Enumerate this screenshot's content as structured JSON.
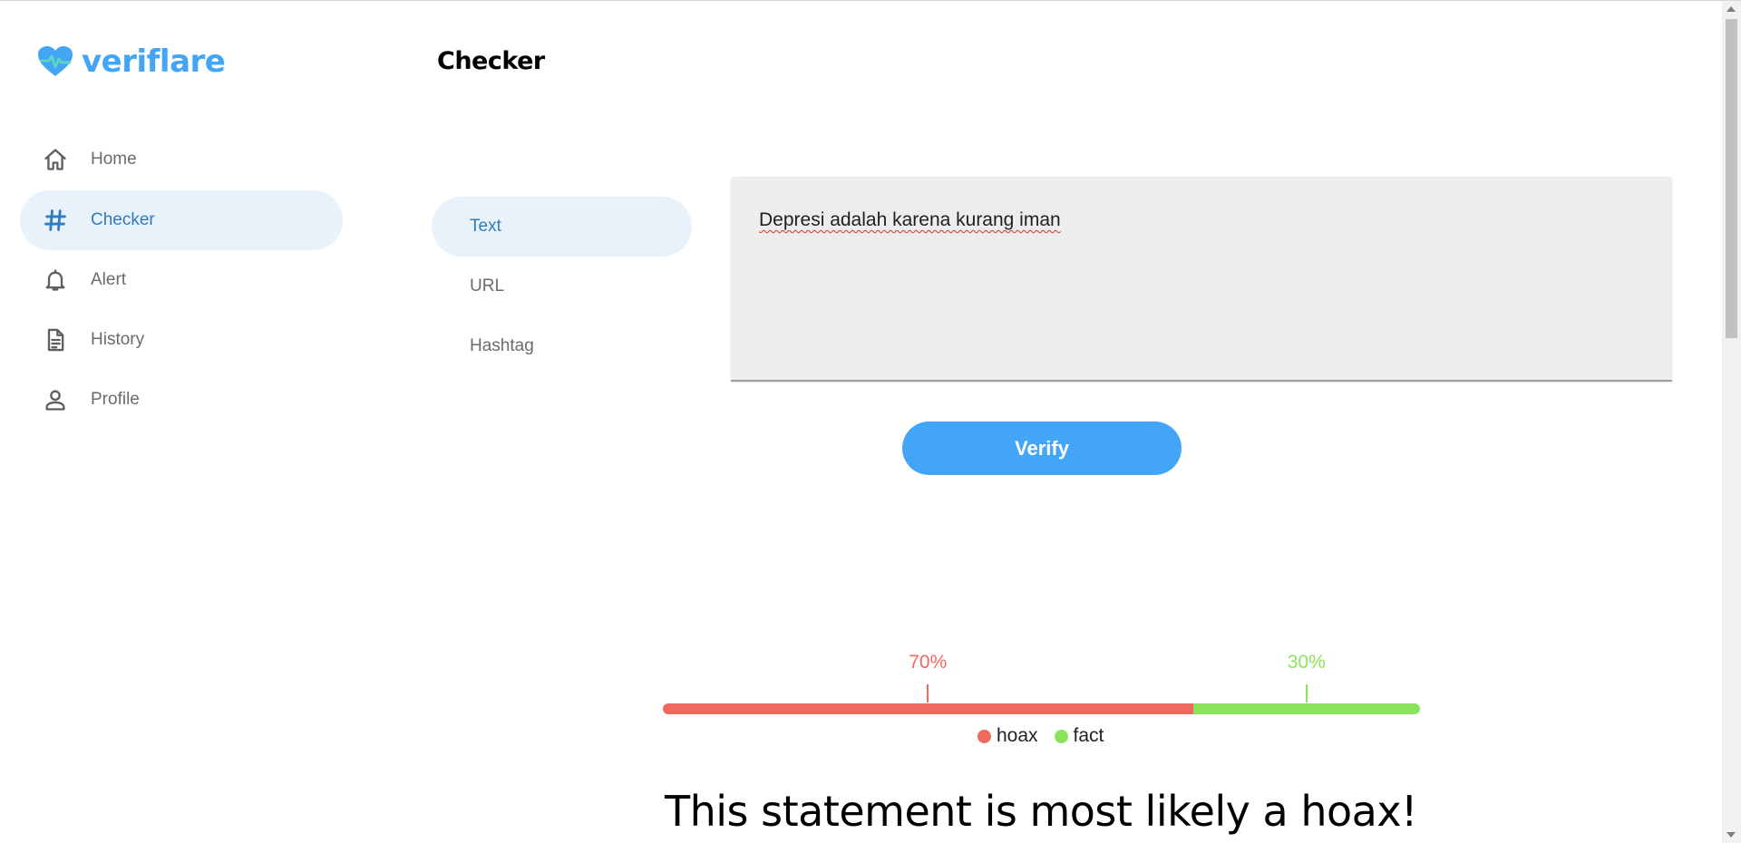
{
  "app": {
    "brand": "veriflare",
    "brand_color": "#42a5f5",
    "logo_icon": "heart-pulse-icon"
  },
  "sidebar": {
    "items": [
      {
        "label": "Home",
        "icon": "home-icon",
        "active": false
      },
      {
        "label": "Checker",
        "icon": "hashtag-icon",
        "active": true
      },
      {
        "label": "Alert",
        "icon": "bell-icon",
        "active": false
      },
      {
        "label": "History",
        "icon": "document-icon",
        "active": false
      },
      {
        "label": "Profile",
        "icon": "person-icon",
        "active": false
      }
    ]
  },
  "main": {
    "title": "Checker",
    "tabs": [
      {
        "label": "Text",
        "active": true
      },
      {
        "label": "URL",
        "active": false
      },
      {
        "label": "Hashtag",
        "active": false
      }
    ],
    "input": {
      "value": "Depresi adalah karena kurang iman"
    },
    "verify_label": "Verify"
  },
  "result": {
    "hoax": {
      "label": "hoax",
      "percent_text": "70%",
      "fraction": 0.7,
      "color": "#f0695e"
    },
    "fact": {
      "label": "fact",
      "percent_text": "30%",
      "fraction": 0.3,
      "color": "#8be35c"
    },
    "verdict": "This statement is most likely a hoax!"
  }
}
